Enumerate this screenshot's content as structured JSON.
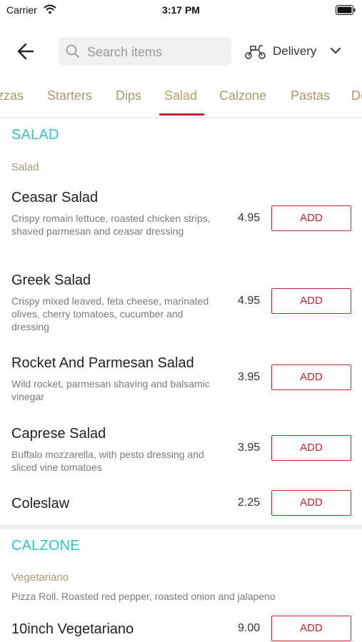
{
  "status_bar": {
    "carrier": "Carrier",
    "time": "3:17 PM"
  },
  "header": {
    "search_placeholder": "Search items",
    "delivery_label": "Delivery",
    "icons": [
      "back-arrow-icon",
      "search-icon",
      "scooter-icon",
      "chevron-down-icon"
    ]
  },
  "tabs": [
    {
      "label": "zzas"
    },
    {
      "label": "Starters"
    },
    {
      "label": "Dips"
    },
    {
      "label": "Salad",
      "active": true
    },
    {
      "label": "Calzone"
    },
    {
      "label": "Pastas"
    },
    {
      "label": "De"
    }
  ],
  "sections": [
    {
      "title": "SALAD",
      "category": "Salad",
      "items": [
        {
          "name": "Ceasar Salad",
          "description": "Crispy romain lettuce, roasted chicken strips, shaved parmesan and ceasar dressing",
          "price": "4.95",
          "add_label": "ADD"
        },
        {
          "name": "Greek Salad",
          "description": "Crispy mixed leaved, feta cheese, marinated olives, cherry tomatoes, cucumber and dressing",
          "price": "4.95",
          "add_label": "ADD"
        },
        {
          "name": "Rocket And Parmesan Salad",
          "description": "Wild rocket, parmesan shaving and balsamic vinegar",
          "price": "3.95",
          "add_label": "ADD"
        },
        {
          "name": "Caprese Salad",
          "description": "Buffalo mozzarella, with pesto dressing and sliced vine tomatoes",
          "price": "3.95",
          "add_label": "ADD"
        },
        {
          "name": "Coleslaw",
          "description": "",
          "price": "2.25",
          "add_label": "ADD"
        }
      ]
    },
    {
      "title": "CALZONE",
      "category": "Vegetariano",
      "category_description": "Pizza Roll. Roasted red pepper, roasted onion and jalapeno",
      "items": [
        {
          "name": "10inch Vegetariano",
          "price": "9.00",
          "add_label": "ADD"
        }
      ]
    }
  ],
  "colors": {
    "accent_red": "#c8232c",
    "section_title": "#2ec4c8",
    "tab_text": "#a89a6f"
  }
}
